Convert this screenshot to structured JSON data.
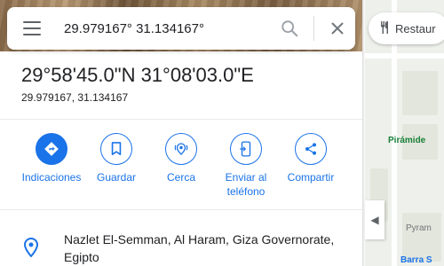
{
  "search": {
    "value": "29.979167° 31.134167°"
  },
  "place": {
    "title": "29°58'45.0\"N 31°08'03.0\"E",
    "decimal": "29.979167, 31.134167"
  },
  "actions": [
    {
      "label": "Indicaciones",
      "icon": "directions-icon"
    },
    {
      "label": "Guardar",
      "icon": "bookmark-icon"
    },
    {
      "label": "Cerca",
      "icon": "nearby-icon"
    },
    {
      "label": "Enviar al teléfono",
      "icon": "send-to-phone-icon"
    },
    {
      "label": "Compartir",
      "icon": "share-icon"
    }
  ],
  "address": {
    "text": "Nazlet El-Semman, Al Haram, Giza Governorate, Egipto"
  },
  "map": {
    "chip_label": "Restaur",
    "labels": [
      "Pirámide",
      "Pyram",
      "Barra S"
    ]
  },
  "colors": {
    "accent": "#1a73e8",
    "text": "#202124",
    "map_green": "#188038"
  }
}
